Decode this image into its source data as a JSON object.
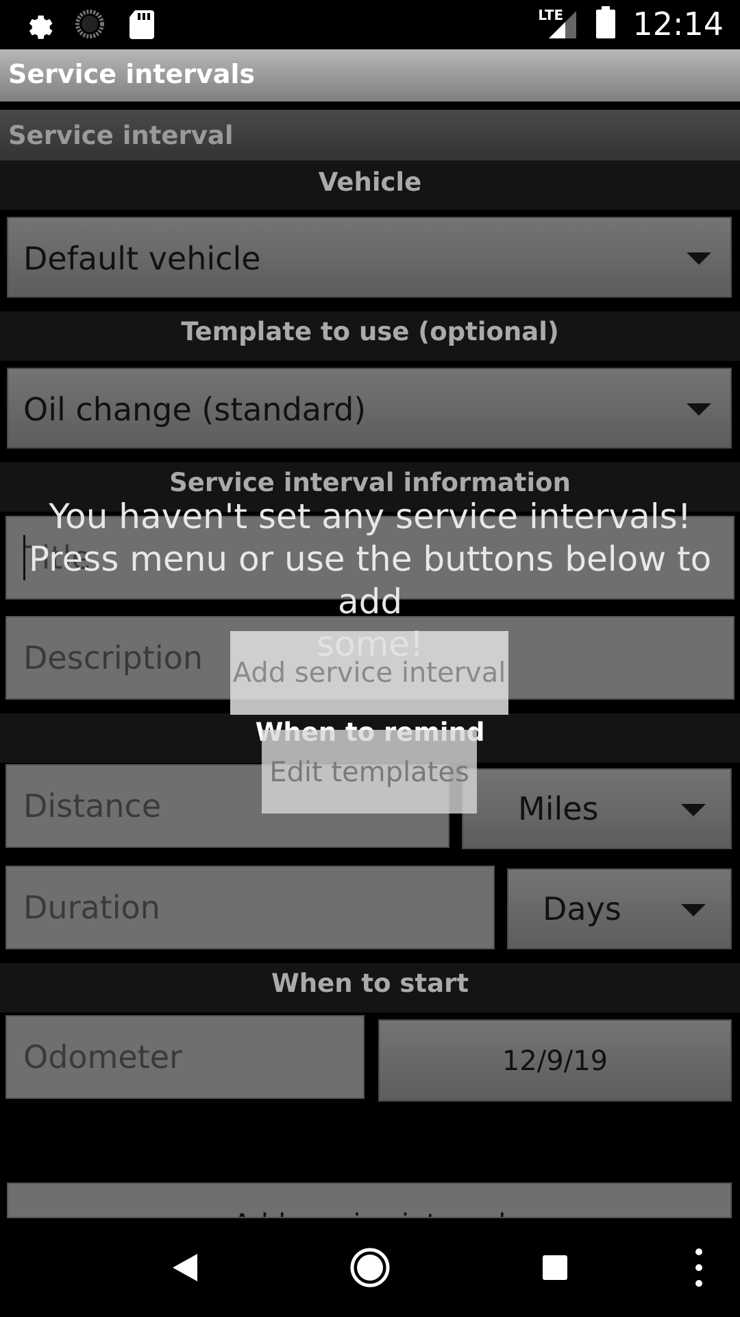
{
  "status_bar": {
    "icons": [
      "settings-icon",
      "sync-icon",
      "sd-card-icon"
    ],
    "network": "LTE",
    "time": "12:14"
  },
  "app_bar": {
    "title": "Service intervals"
  },
  "section": {
    "title": "Service interval"
  },
  "vehicle": {
    "label": "Vehicle",
    "selected": "Default vehicle"
  },
  "template": {
    "label": "Template to use (optional)",
    "selected": "Oil change (standard)"
  },
  "info": {
    "label": "Service interval information",
    "title_placeholder": "Title",
    "description_placeholder": "Description"
  },
  "remind": {
    "label": "When to remind",
    "distance_placeholder": "Distance",
    "distance_unit": "Miles",
    "duration_placeholder": "Duration",
    "duration_unit": "Days"
  },
  "start": {
    "label": "When to start",
    "odometer_placeholder": "Odometer",
    "date": "12/9/19"
  },
  "overlay": {
    "line1": "You haven't set any service intervals!",
    "line2": "Press menu or use the buttons below to add",
    "line3": "some!",
    "add_button": "Add service interval",
    "edit_button": "Edit templates"
  },
  "bottom_button": "Add service interval",
  "nav": [
    "back-icon",
    "home-icon",
    "recents-icon",
    "overflow-menu-icon"
  ]
}
